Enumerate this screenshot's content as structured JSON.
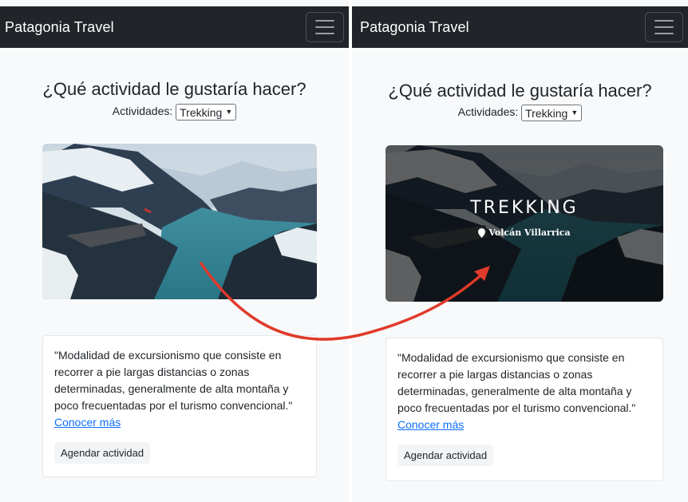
{
  "left": {
    "brand": "Patagonia Travel",
    "heading": "¿Qué actividad le gustaría hacer?",
    "selector_label": "Actividades:",
    "selected_activity": "Trekking",
    "description": "\"Modalidad de excursionismo que consiste en recorrer a pie largas distancias o zonas determinadas, generalmente de alta montaña y poco frecuentadas por el turismo convencional.\"",
    "link_label": "Conocer más",
    "button_label": "Agendar actividad"
  },
  "right": {
    "brand": "Patagonia Travel",
    "heading": "¿Qué actividad le gustaría hacer?",
    "selector_label": "Actividades:",
    "selected_activity": "Trekking",
    "hero_title": "TREKKING",
    "hero_location": "Volcán Villarrica",
    "description": "\"Modalidad de excursionismo que consiste en recorrer a pie largas distancias o zonas determinadas, generalmente de alta montaña y poco frecuentadas por el turismo convencional.\"",
    "link_label": "Conocer más",
    "button_label": "Agendar actividad"
  },
  "icons": {
    "menu": "hamburger-icon",
    "location": "map-pin-icon",
    "dropdown": "chevron-down-icon"
  },
  "colors": {
    "navbar": "#212529",
    "page_bg": "#f8f9fa",
    "link": "#0d6efd",
    "arrow": "#e03a2b"
  }
}
